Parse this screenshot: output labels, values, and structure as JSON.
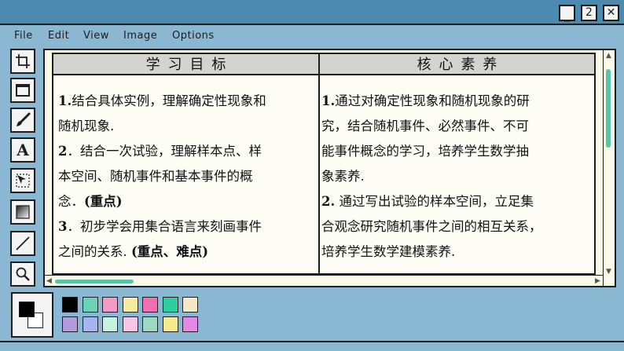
{
  "window": {
    "minimize_glyph": "_",
    "restore_glyph": "2",
    "close_glyph": "✕"
  },
  "menu": [
    "File",
    "Edit",
    "View",
    "Image",
    "Options"
  ],
  "tools": [
    "crop-icon",
    "rectangle-icon",
    "brush-icon",
    "text-icon",
    "select-icon",
    "gradient-icon",
    "line-icon",
    "zoom-icon"
  ],
  "tool_text_glyph": "A",
  "table": {
    "headers": [
      "学习目标",
      "核心素养"
    ],
    "left_lines": [
      [
        {
          "t": "1.",
          "b": true
        },
        {
          "t": "结合具体实例，理解确定性现象和"
        }
      ],
      [
        {
          "t": "随机现象."
        }
      ],
      [
        {
          "t": "2",
          "b": true
        },
        {
          "t": "．结合一次试验，理解样本点、样"
        }
      ],
      [
        {
          "t": "本空间、随机事件和基本事件的概"
        }
      ],
      [
        {
          "t": "念．"
        },
        {
          "t": "(重点)",
          "b": true
        }
      ],
      [
        {
          "t": "3",
          "b": true
        },
        {
          "t": "．初步学会用集合语言来刻画事件"
        }
      ],
      [
        {
          "t": "之间的关系. "
        },
        {
          "t": "(重点、难点)",
          "b": true
        }
      ]
    ],
    "right_lines": [
      [
        {
          "t": "1.",
          "b": true
        },
        {
          "t": "通过对确定性现象和随机现象的研"
        }
      ],
      [
        {
          "t": "究，结合随机事件、必然事件、不可"
        }
      ],
      [
        {
          "t": "能事件概念的学习，培养学生数学抽"
        }
      ],
      [
        {
          "t": "象素养."
        }
      ],
      [
        {
          "t": "2.",
          "b": true
        },
        {
          "t": " 通过写出试验的样本空间，立足集"
        }
      ],
      [
        {
          "t": "合观念研究随机事件之间的相互关系，"
        }
      ],
      [
        {
          "t": "培养学生数学建模素养."
        }
      ]
    ]
  },
  "colors": {
    "primary": "#000000",
    "secondary": "#ffffff",
    "row1": [
      "#000000",
      "#6cd3b5",
      "#f49ac9",
      "#f7eba2",
      "#f46fb2",
      "#2dcfa0",
      "#f4e8c6"
    ],
    "row2": [
      "#b39bde",
      "#a8b3f2",
      "#c8f2e4",
      "#f6c6e4",
      "#9ed9c4",
      "#f8eb8c",
      "#e688e8"
    ]
  }
}
